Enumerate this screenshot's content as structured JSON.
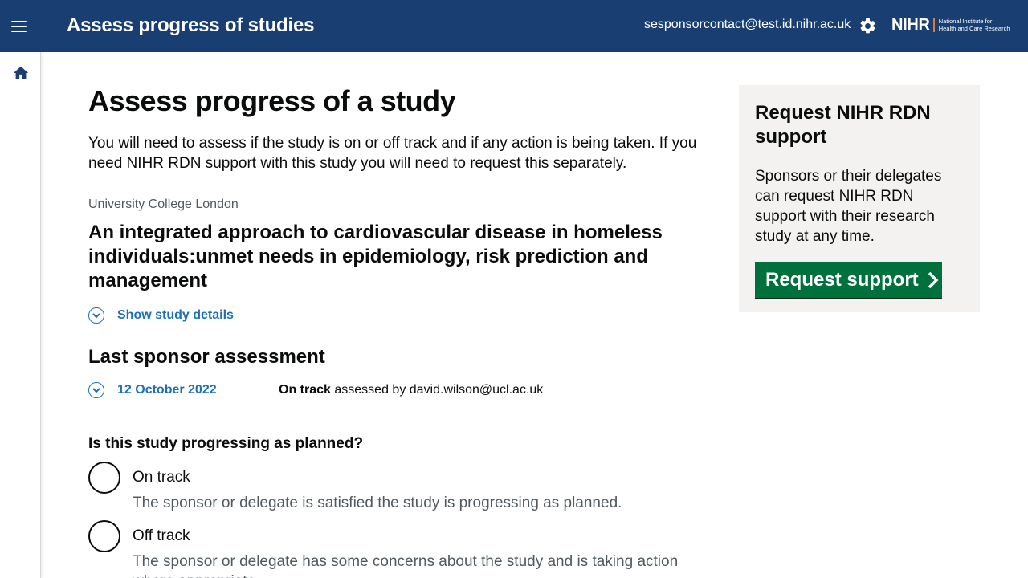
{
  "header": {
    "app_title": "Assess progress of studies",
    "user_email": "sesponsorcontact@test.id.nihr.ac.uk",
    "logo": {
      "mark": "NIHR",
      "line1": "National Institute for",
      "line2": "Health and Care Research"
    },
    "icons": [
      "menu-icon",
      "gear-icon"
    ]
  },
  "rail": {
    "icons": [
      "home-icon"
    ]
  },
  "page": {
    "title": "Assess progress of a study",
    "intro": "You will need to assess if the study is on or off track and if any action is being taken. If you need NIHR RDN support with this study you will need to request this separately.",
    "organisation": "University College London",
    "study_title": "An integrated approach to cardiovascular disease in homeless individuals:unmet needs in epidemiology, risk prediction and management",
    "show_details_label": "Show study details"
  },
  "last_assessment": {
    "heading": "Last sponsor assessment",
    "date": "12 October 2022",
    "status": "On track",
    "assessed_by_text": "assessed by david.wilson@ucl.ac.uk"
  },
  "question": {
    "label": "Is this study progressing as planned?",
    "options": [
      {
        "label": "On track",
        "hint": "The sponsor or delegate is satisfied the study is progressing as planned.",
        "selected": false
      },
      {
        "label": "Off track",
        "hint": "The sponsor or delegate has some concerns about the study and is taking action where appropriate.",
        "selected": false
      }
    ]
  },
  "aside": {
    "title": "Request NIHR RDN support",
    "text": "Sponsors or their delegates can request NIHR RDN support with their research study at any time.",
    "button_label": "Request support"
  },
  "colors": {
    "header_bg": "#193e72",
    "link": "#1d70b8",
    "button_green": "#00703c",
    "aside_bg": "#f3f2f1",
    "hint_grey": "#505a5f"
  }
}
